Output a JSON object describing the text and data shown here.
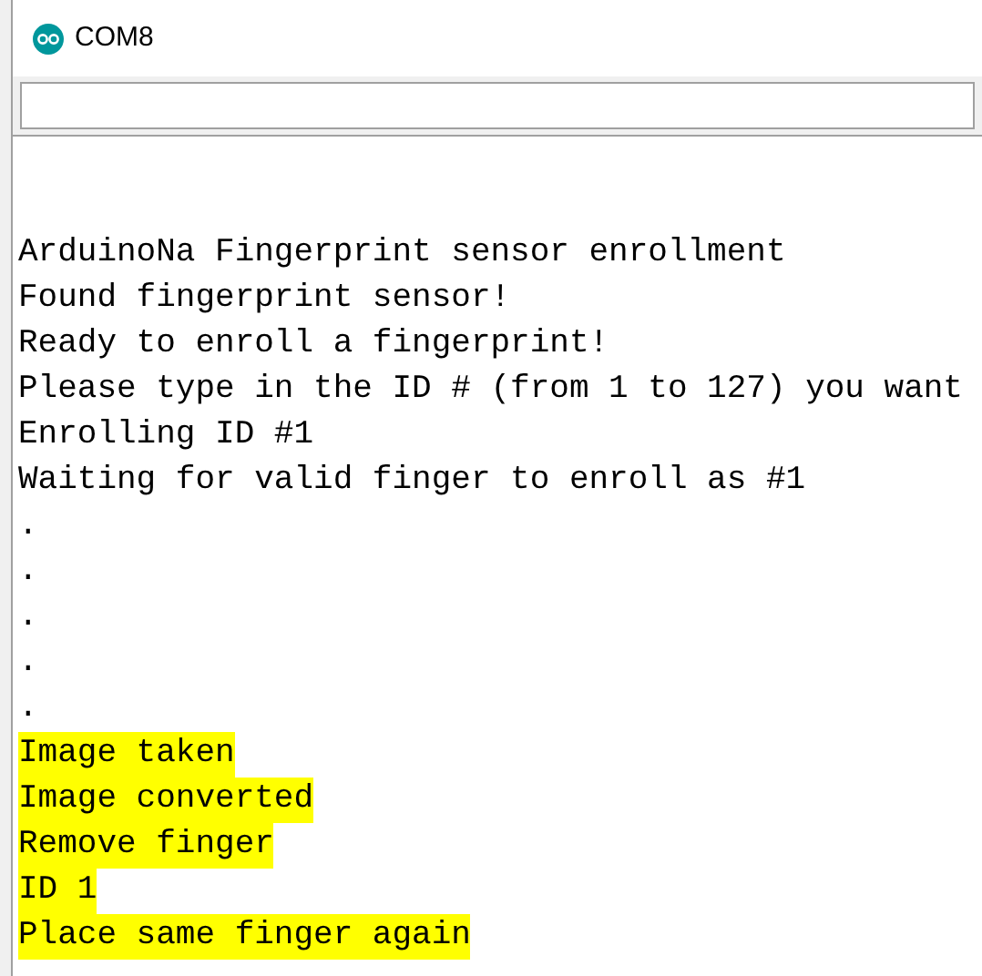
{
  "window": {
    "title": "COM8"
  },
  "output": [
    {
      "text": "ArduinoNa Fingerprint sensor enrollment",
      "highlighted": false
    },
    {
      "text": "Found fingerprint sensor!",
      "highlighted": false
    },
    {
      "text": "Ready to enroll a fingerprint!",
      "highlighted": false
    },
    {
      "text": "Please type in the ID # (from 1 to 127) you want",
      "highlighted": false
    },
    {
      "text": "Enrolling ID #1",
      "highlighted": false
    },
    {
      "text": "Waiting for valid finger to enroll as #1",
      "highlighted": false
    },
    {
      "text": ".",
      "highlighted": false
    },
    {
      "text": ".",
      "highlighted": false
    },
    {
      "text": ".",
      "highlighted": false
    },
    {
      "text": ".",
      "highlighted": false
    },
    {
      "text": ".",
      "highlighted": false
    },
    {
      "text": "Image taken",
      "highlighted": true
    },
    {
      "text": "Image converted",
      "highlighted": true
    },
    {
      "text": "Remove finger",
      "highlighted": true
    },
    {
      "text": "ID 1",
      "highlighted": true
    },
    {
      "text": "Place same finger again",
      "highlighted": true
    }
  ]
}
